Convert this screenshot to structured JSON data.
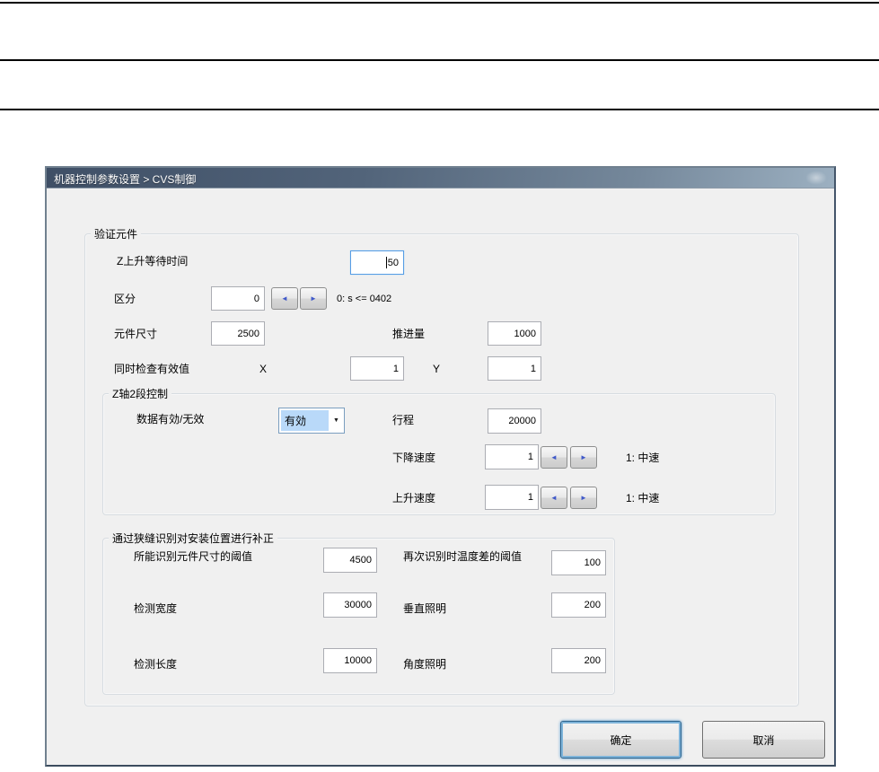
{
  "window": {
    "title": "机器控制参数设置 > CVS制御"
  },
  "verify_group": {
    "label": "验证元件",
    "z_wait_label": "Z上升等待时间",
    "z_wait_value": "50",
    "category_label": "区分",
    "category_value": "0",
    "category_hint": "0: s <= 0402",
    "comp_size_label": "元件尺寸",
    "comp_size_value": "2500",
    "advance_label": "推进量",
    "advance_value": "1000",
    "simul_label": "同时检查有效值",
    "x_label": "X",
    "x_value": "1",
    "y_label": "Y",
    "y_value": "1"
  },
  "zaxis_group": {
    "label": "Z轴2段控制",
    "data_valid_label": "数据有効/无效",
    "data_valid_value": "有効",
    "stroke_label": "行程",
    "stroke_value": "20000",
    "down_label": "下降速度",
    "down_value": "1",
    "down_hint": "1: 中速",
    "up_label": "上升速度",
    "up_value": "1",
    "up_hint": "1: 中速"
  },
  "slit_group": {
    "label": "通过狭缝识别对安装位置进行补正",
    "rows": [
      {
        "l_label": "所能识别元件尺寸的阈值",
        "l_value": "4500",
        "r_label": "再次识别时温度差的阈值",
        "r_value": "100"
      },
      {
        "l_label": "检测宽度",
        "l_value": "30000",
        "r_label": "垂直照明",
        "r_value": "200"
      },
      {
        "l_label": "检测长度",
        "l_value": "10000",
        "r_label": "角度照明",
        "r_value": "200"
      }
    ]
  },
  "buttons": {
    "ok": "确定",
    "cancel": "取消"
  },
  "icons": {
    "spin_left": "◄",
    "spin_right": "►",
    "dropdown": "▼"
  },
  "colors": {
    "titlebar_dark": "#3f4f66",
    "titlebar_light": "#9cb0c1",
    "focus_blue": "#569de5",
    "selection_blue": "#b9d9f9"
  }
}
